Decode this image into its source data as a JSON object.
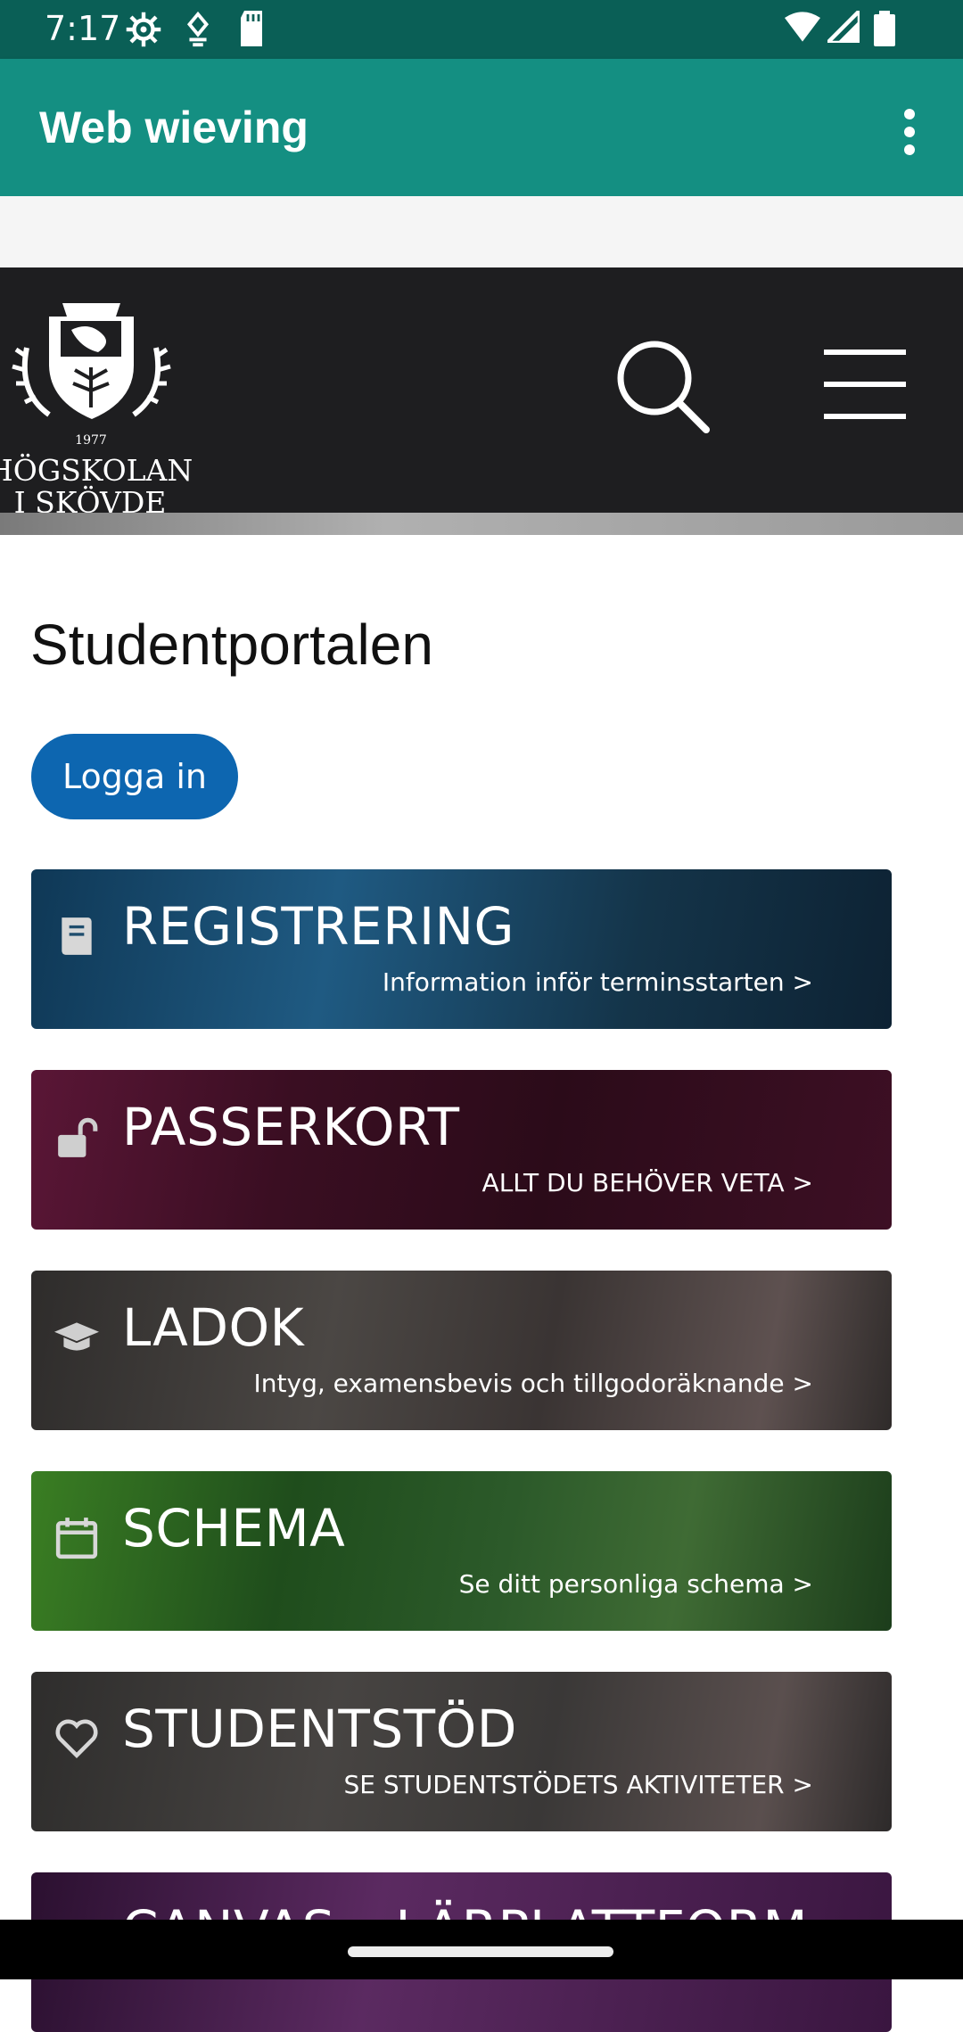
{
  "status_bar": {
    "time": "7:17",
    "icons": [
      "settings-icon",
      "location-icon",
      "sd-card-icon",
      "wifi-icon",
      "signal-icon",
      "battery-icon"
    ]
  },
  "app_bar": {
    "title": "Web wieving",
    "menu_icon": "more-vert-icon"
  },
  "site_header": {
    "logo_year": "1977",
    "logo_line1": "HÖGSKOLAN",
    "logo_line2": "I SKÖVDE",
    "search_icon": "search-icon",
    "menu_icon": "hamburger-icon"
  },
  "page": {
    "title": "Studentportalen",
    "login_label": "Logga in"
  },
  "tiles": [
    {
      "title": "REGISTRERING",
      "subtitle": "Information inför terminsstarten >",
      "icon": "book-icon",
      "bg": "#1d4664"
    },
    {
      "title": "PASSERKORT",
      "subtitle": "ALLT DU BEHÖVER VETA >",
      "icon": "unlock-icon",
      "bg": "#3a0e22"
    },
    {
      "title": "LADOK",
      "subtitle": "Intyg, examensbevis och tillgodoräknande >",
      "icon": "graduation-cap-icon",
      "bg": "#3a3633"
    },
    {
      "title": "SCHEMA",
      "subtitle": "Se ditt personliga schema >",
      "icon": "calendar-icon",
      "bg": "#1f4d1c"
    },
    {
      "title": "STUDENTSTÖD",
      "subtitle": "SE STUDENTSTÖDETS AKTIVITETER >",
      "icon": "heart-icon",
      "bg": "#3b3a3a"
    },
    {
      "title": "CANVAS – LÄRPLATTFORM",
      "subtitle": "",
      "icon": "canvas-icon",
      "bg": "#3a1640"
    }
  ],
  "colors": {
    "status_bar": "#0a5f56",
    "app_bar": "#148f82",
    "site_header": "#1e1e20",
    "login_button": "#0d66b0"
  }
}
